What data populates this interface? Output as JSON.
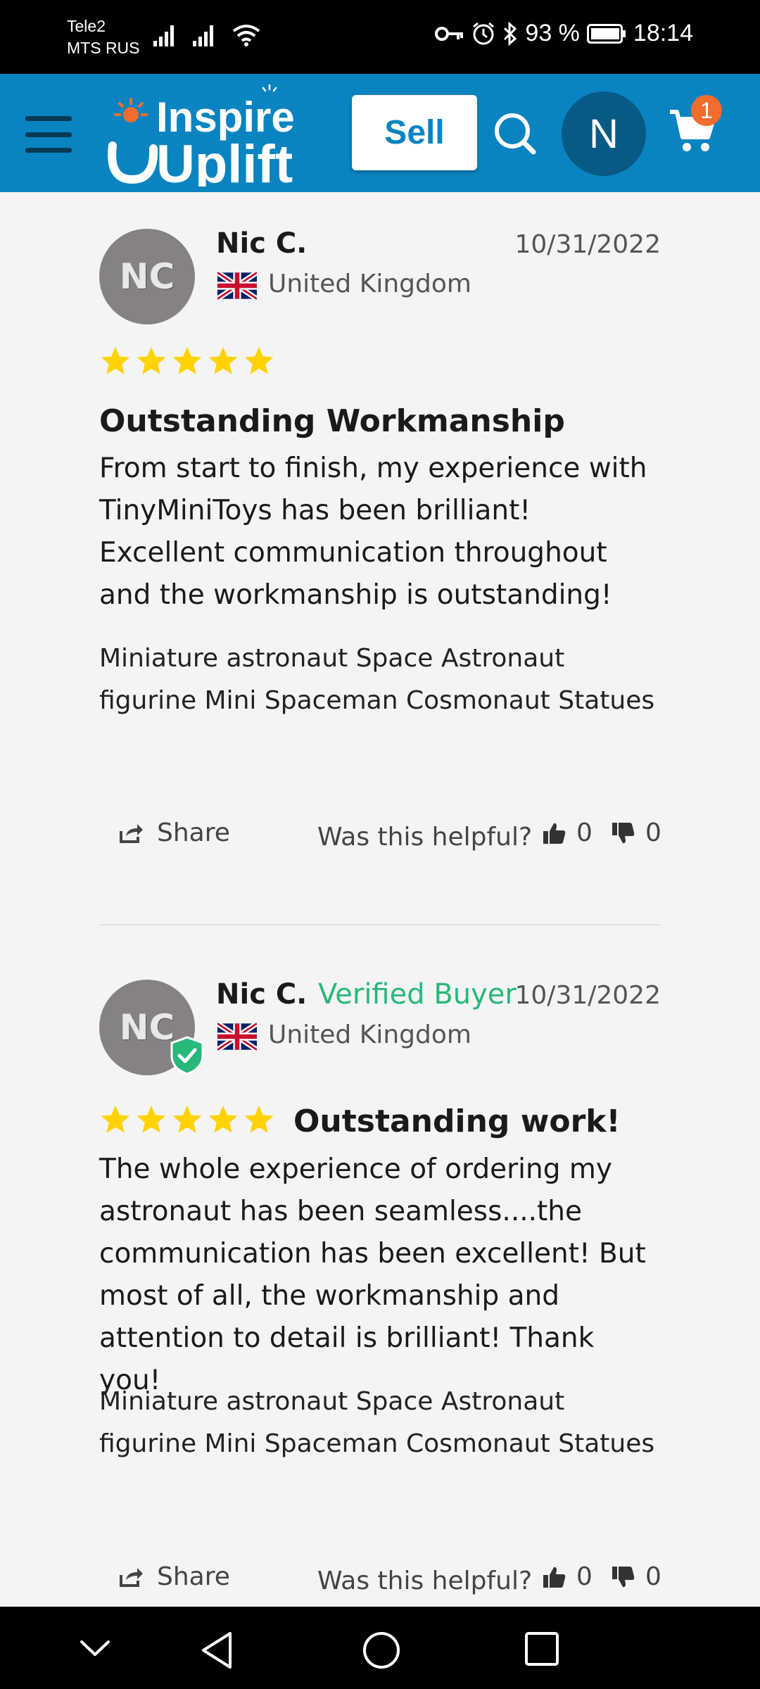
{
  "status_bar": {
    "carrier_1": "Tele2",
    "carrier_2": "MTS RUS",
    "battery": "93 %",
    "time": "18:14"
  },
  "header": {
    "logo_line_1": "Inspire",
    "logo_line_2": "Uplift",
    "sell_label": "Sell",
    "avatar_initial": "N",
    "cart_count": "1",
    "brand_color": "#0a84c0",
    "badge_color": "#f26c2d"
  },
  "reviews": [
    {
      "initials": "NC",
      "name": "Nic C.",
      "verified_label": "",
      "date": "10/31/2022",
      "country": "United Kingdom",
      "rating": 5,
      "title": "Outstanding Workmanship",
      "body": "From start to finish, my experience with TinyMiniToys has been brilliant! Excellent communication throughout and the workmanship is outstanding!",
      "product": "Miniature astronaut Space Astronaut figurine Mini Spaceman Cosmonaut Statues",
      "share_label": "Share",
      "helpful_label": "Was this helpful?",
      "helpful_up": "0",
      "helpful_down": "0"
    },
    {
      "initials": "NC",
      "name": "Nic C.",
      "verified_label": "Verified Buyer",
      "date": "10/31/2022",
      "country": "United Kingdom",
      "rating": 5,
      "title": "Outstanding work!",
      "body": "The whole experience of ordering my astronaut has been seamless....the communication has been excellent! But most of all, the workmanship and attention to detail is brilliant! Thank you!",
      "product": "Miniature astronaut Space Astronaut figurine Mini Spaceman Cosmonaut Statues",
      "share_label": "Share",
      "helpful_label": "Was this helpful?",
      "helpful_up": "0",
      "helpful_down": "0"
    }
  ],
  "icons": {
    "menu": "menu-icon",
    "search": "search-icon",
    "cart": "cart-icon",
    "star": "star-icon",
    "share": "share-icon",
    "thumb_up": "thumbs-up-icon",
    "thumb_down": "thumbs-down-icon",
    "verified": "verified-check-icon"
  },
  "colors": {
    "star": "#ffd200",
    "verified": "#27b87a",
    "avatar_bg": "#878282"
  }
}
